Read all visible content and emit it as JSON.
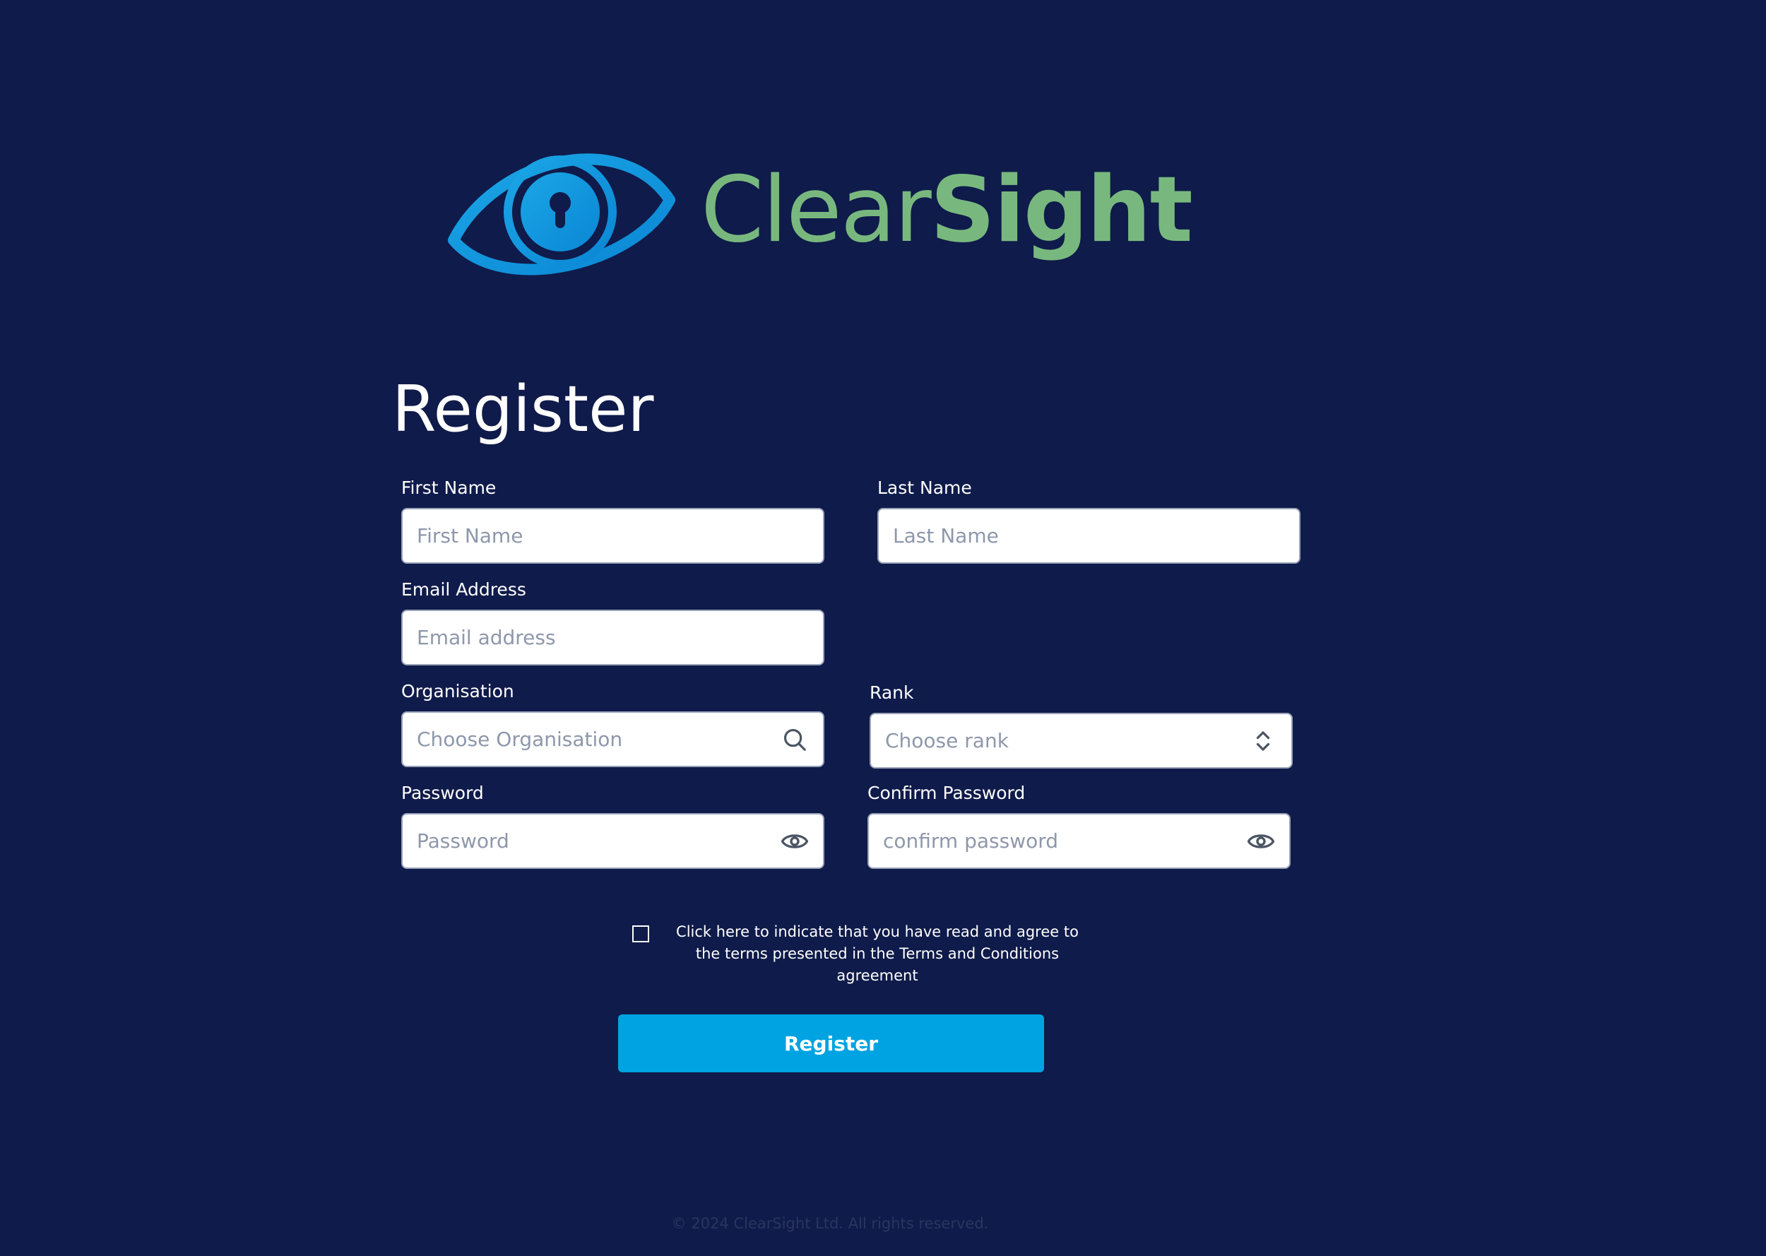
{
  "brand": {
    "name_light": "Clear",
    "name_bold": "Sight",
    "icon": "eye-keyhole-logo",
    "text_color": "#78b87e",
    "icon_color": "#00a3e1"
  },
  "page": {
    "title": "Register",
    "background_color": "#0f1b4a"
  },
  "form": {
    "first_name": {
      "label": "First Name",
      "placeholder": "First Name"
    },
    "last_name": {
      "label": "Last Name",
      "placeholder": "Last Name"
    },
    "email": {
      "label": "Email Address",
      "placeholder": "Email address"
    },
    "organisation": {
      "label": "Organisation",
      "placeholder": "Choose Organisation",
      "icon": "search-icon"
    },
    "rank": {
      "label": "Rank",
      "placeholder": "Choose rank",
      "icon": "chevron-up-down-icon"
    },
    "password": {
      "label": "Password",
      "placeholder": "Password",
      "icon": "eye-icon"
    },
    "confirm_password": {
      "label": "Confirm Password",
      "placeholder": "confirm password",
      "icon": "eye-icon"
    },
    "terms": {
      "checked": false,
      "text": "Click here to indicate that you have read and agree to the terms presented in the Terms and Conditions agreement"
    },
    "submit_label": "Register",
    "submit_color": "#00a3e1"
  },
  "footer": {
    "copyright": "© 2024 ClearSight Ltd. All rights reserved."
  }
}
